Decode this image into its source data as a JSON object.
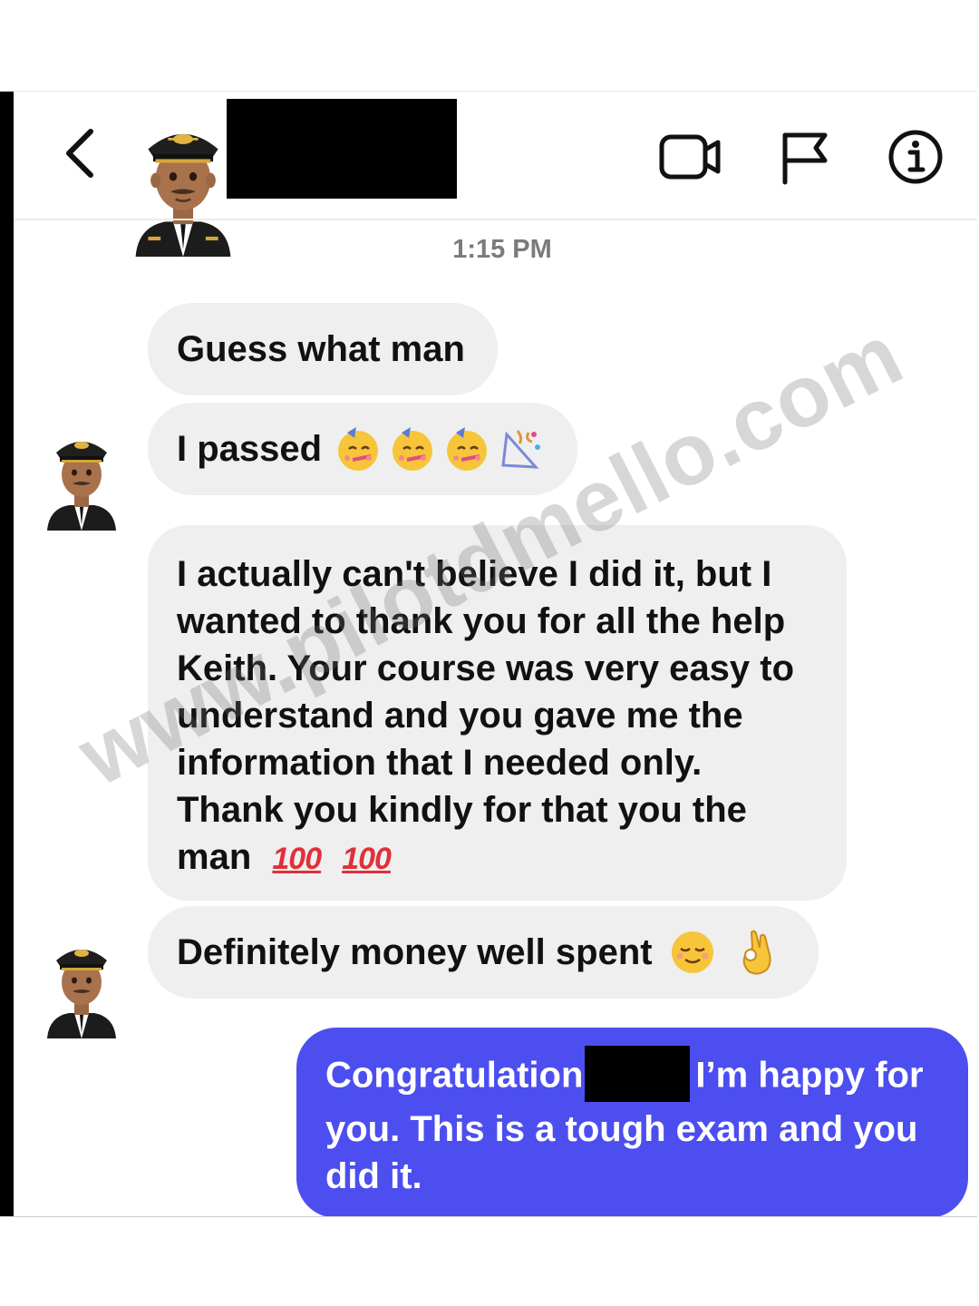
{
  "header": {
    "back_icon": "chevron-left-icon",
    "contact_avatar": "pilot-emoji-avatar",
    "contact_name": "",
    "actions": [
      "video-call-icon",
      "flag-icon",
      "info-icon"
    ]
  },
  "timestamp": "1:15 PM",
  "messages": {
    "m1": {
      "text": "Guess what man"
    },
    "m2": {
      "text": "I passed",
      "emoji": [
        "partying-face",
        "partying-face",
        "partying-face",
        "party-popper"
      ]
    },
    "m3": {
      "lines": [
        "I actually can't believe I did it, but I",
        "wanted to thank you for all the help",
        "Keith. Your course was very easy to",
        "understand and you gave me the",
        "information that I needed only.",
        "Thank you kindly for that you the",
        "man"
      ],
      "hundreds": [
        "100",
        "100"
      ]
    },
    "m4": {
      "text": "Definitely money well spent",
      "emoji": [
        "relieved-face",
        "ok-hand"
      ]
    },
    "m5": {
      "line1_pre": "Congratulation",
      "line1_post": "I’m happy for",
      "line2": "you. This is a tough exam and you",
      "line3": "did it."
    }
  },
  "watermark": "www.pilotdmello.com",
  "colors": {
    "sent_bubble": "#4c4ef0",
    "received_bubble": "#efefef",
    "timestamp": "#7b7b7b"
  }
}
